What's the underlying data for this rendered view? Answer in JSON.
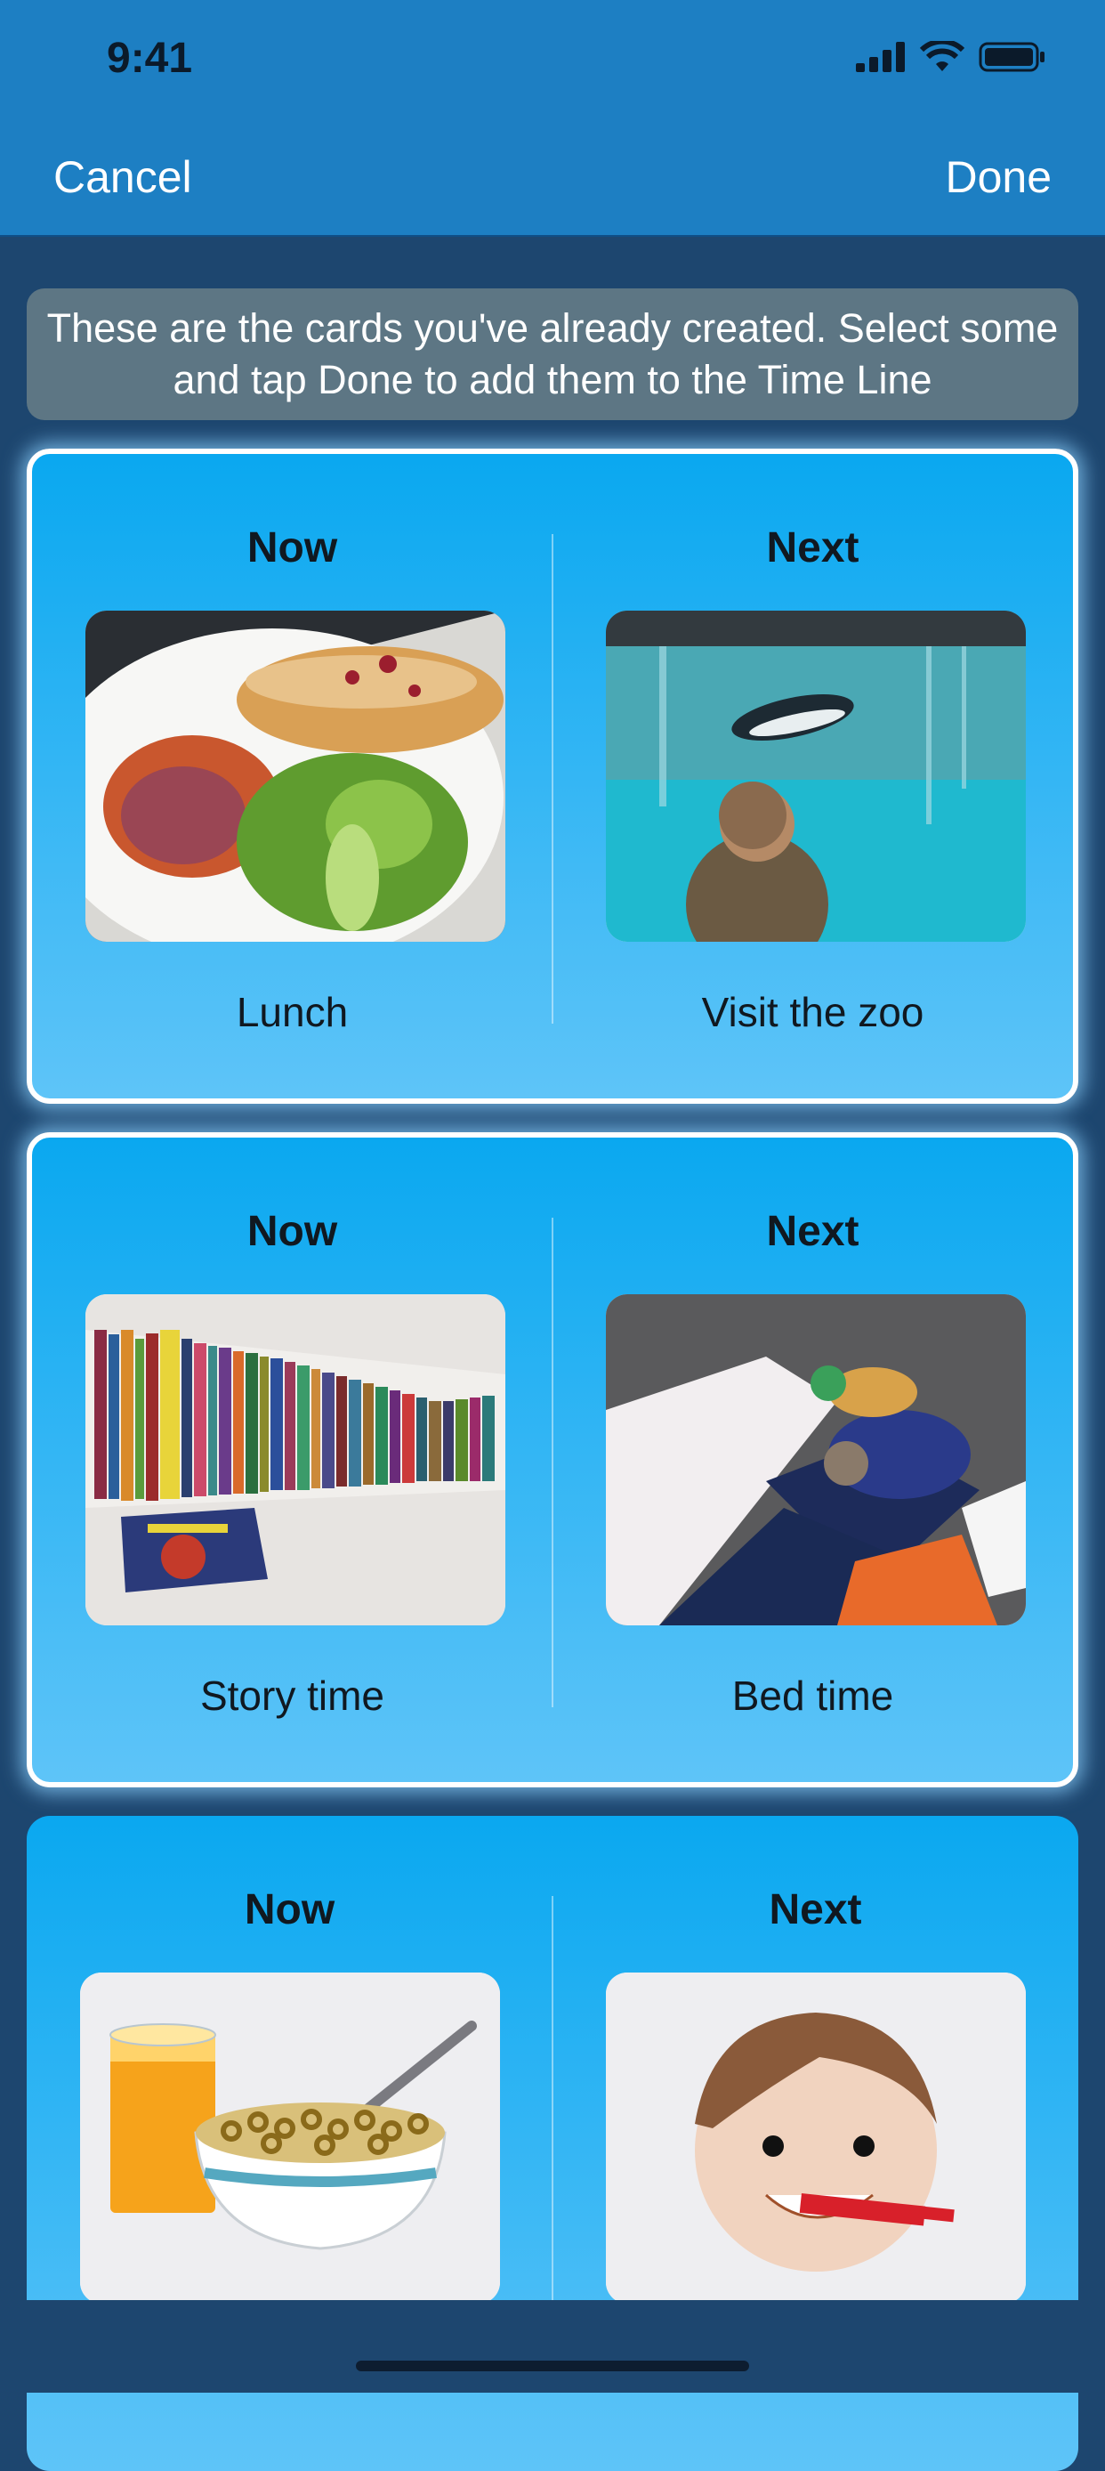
{
  "status": {
    "time": "9:41"
  },
  "nav": {
    "cancel_label": "Cancel",
    "done_label": "Done"
  },
  "instruction": "These are the cards you've already created.  Select some and tap Done to add them to the Time Line",
  "cards": [
    {
      "selected": true,
      "now_title": "Now",
      "next_title": "Next",
      "now_label": "Lunch",
      "next_label": "Visit the zoo",
      "now_image": "lunch-photo",
      "next_image": "zoo-penguin-photo"
    },
    {
      "selected": true,
      "now_title": "Now",
      "next_title": "Next",
      "now_label": "Story time",
      "next_label": "Bed time",
      "now_image": "books-photo",
      "next_image": "bed-photo"
    },
    {
      "selected": false,
      "now_title": "Now",
      "next_title": "Next",
      "now_label": "",
      "next_label": "",
      "now_image": "breakfast-cereal-illustration",
      "next_image": "brushing-teeth-illustration"
    }
  ],
  "colors": {
    "nav_bg": "#1d7fc3",
    "page_bg": "#1d466f",
    "card_top": "#0aa8f0",
    "card_bottom": "#5ec4f8",
    "instruction_bg": "#5d7684"
  }
}
